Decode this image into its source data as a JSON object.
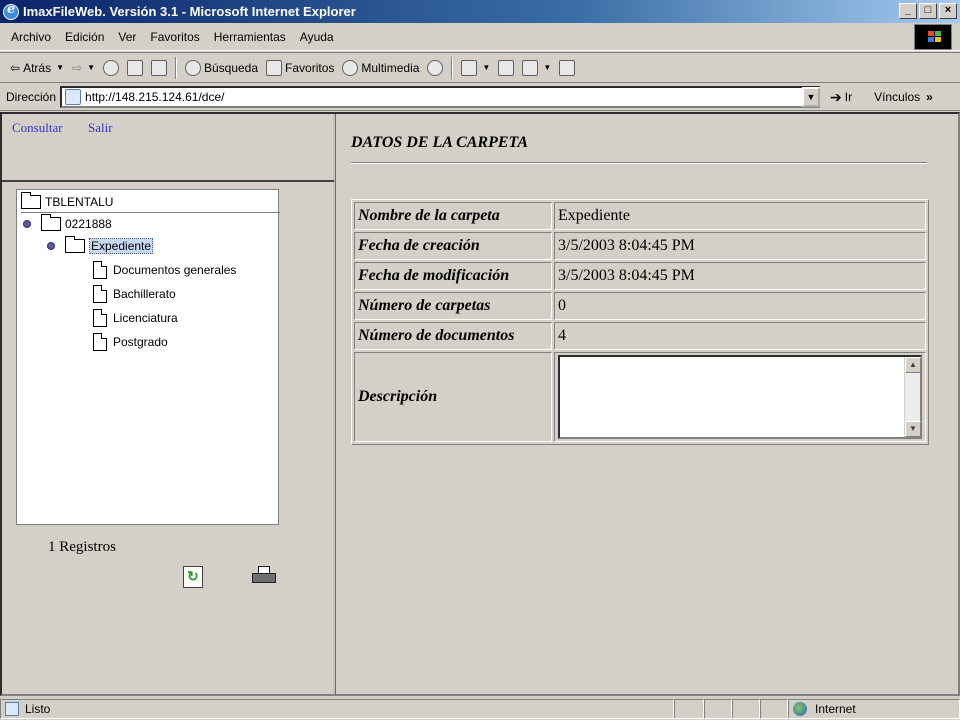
{
  "window": {
    "title": "ImaxFileWeb. Versión 3.1 - Microsoft Internet Explorer"
  },
  "menu": [
    "Archivo",
    "Edición",
    "Ver",
    "Favoritos",
    "Herramientas",
    "Ayuda"
  ],
  "toolbar": {
    "back": "Atrás",
    "search": "Búsqueda",
    "favorites": "Favoritos",
    "media": "Multimedia"
  },
  "address": {
    "label": "Dirección",
    "url": "http://148.215.124.61/dce/",
    "go": "Ir",
    "links": "Vínculos"
  },
  "nav": {
    "consultar": "Consultar",
    "salir": "Salir"
  },
  "tree": {
    "root": "TBLENTALU",
    "record": "0221888",
    "folder": "Expediente",
    "documents": [
      "Documentos generales",
      "Bachillerato",
      "Licenciatura",
      "Postgrado"
    ]
  },
  "registros": "1 Registros",
  "detail": {
    "heading": "DATOS DE LA CARPETA",
    "rows": [
      {
        "label": "Nombre de la carpeta",
        "value": "Expediente"
      },
      {
        "label": "Fecha de creación",
        "value": "3/5/2003 8:04:45 PM"
      },
      {
        "label": "Fecha de modificación",
        "value": "3/5/2003 8:04:45 PM"
      },
      {
        "label": "Número de carpetas",
        "value": "0"
      },
      {
        "label": "Número de documentos",
        "value": "4"
      }
    ],
    "description_label": "Descripción",
    "description_value": ""
  },
  "status": {
    "text": "Listo",
    "zone": "Internet"
  }
}
